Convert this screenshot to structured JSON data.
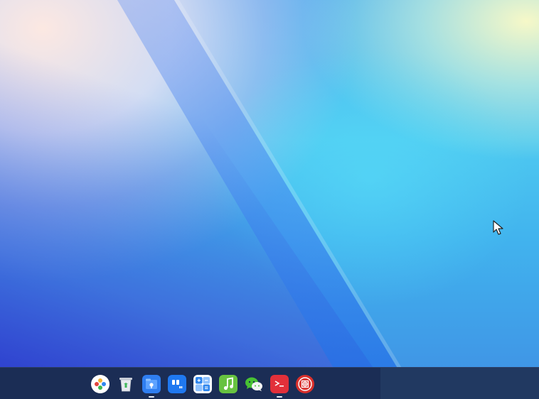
{
  "desktop": {
    "wallpaper": "abstract-blue-gradient-wallpaper"
  },
  "taskbar": {
    "apps": [
      {
        "id": "launcher",
        "icon": "launcher-icon",
        "color": "#ffffff",
        "running": false
      },
      {
        "id": "trash",
        "icon": "trash-icon",
        "color": "#dfe3ea",
        "running": false
      },
      {
        "id": "file-manager",
        "icon": "file-manager-icon",
        "color": "#2f7ef0",
        "running": true
      },
      {
        "id": "quotes",
        "icon": "quote-app-icon",
        "color": "#1f78f0",
        "running": false
      },
      {
        "id": "calculator",
        "icon": "calculator-icon",
        "color": "#2f86ee",
        "running": false
      },
      {
        "id": "music",
        "icon": "music-icon",
        "color": "#67c240",
        "running": false
      },
      {
        "id": "wechat",
        "icon": "wechat-icon",
        "color": "#48c233",
        "running": false
      },
      {
        "id": "terminal",
        "icon": "terminal-icon",
        "color": "#e2303a",
        "running": true
      },
      {
        "id": "settings",
        "icon": "red-seal-app-icon",
        "color": "#d8302c",
        "running": false
      }
    ]
  },
  "cursor": {
    "icon": "mouse-pointer-icon"
  }
}
